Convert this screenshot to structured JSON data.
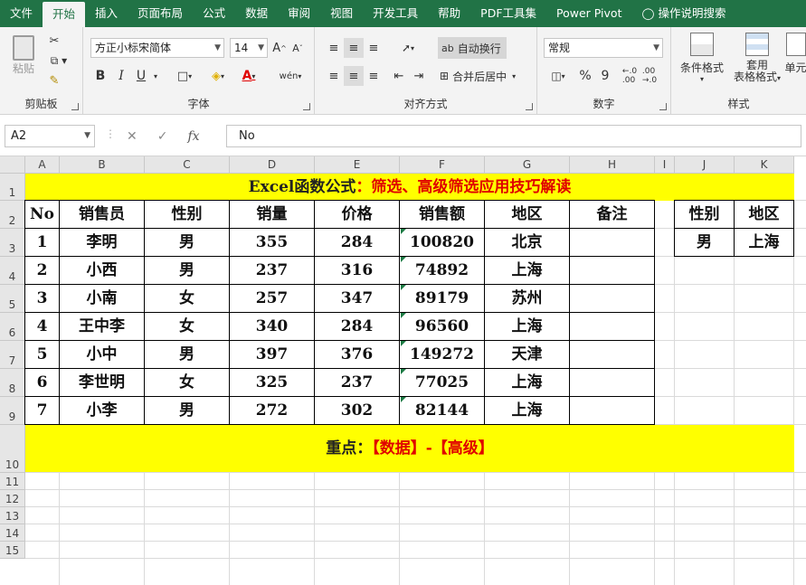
{
  "ribbon_tabs": [
    "文件",
    "开始",
    "插入",
    "页面布局",
    "公式",
    "数据",
    "审阅",
    "视图",
    "开发工具",
    "帮助",
    "PDF工具集",
    "Power Pivot",
    "操作说明搜索"
  ],
  "ribbon": {
    "clipboard": {
      "paste": "粘贴",
      "label": "剪贴板"
    },
    "font": {
      "name": "方正小标宋简体",
      "size": "14",
      "bold": "B",
      "italic": "I",
      "underline": "U",
      "label": "字体",
      "grow": "A",
      "shrink": "A",
      "phonetic": "wén"
    },
    "alignment": {
      "wrap": "自动换行",
      "merge": "合并后居中",
      "label": "对齐方式"
    },
    "number": {
      "format": "常规",
      "percent": "%",
      "comma": "9",
      "label": "数字"
    },
    "styles": {
      "conditional": "条件格式",
      "table_line1": "套用",
      "table_line2": "表格格式",
      "cell": "单元",
      "label": "样式"
    }
  },
  "formula_bar": {
    "name_box": "A2",
    "fx": "fx",
    "value": "No"
  },
  "columns": [
    "A",
    "B",
    "C",
    "D",
    "E",
    "F",
    "G",
    "H",
    "I",
    "J",
    "K"
  ],
  "rows": [
    "1",
    "2",
    "3",
    "4",
    "5",
    "6",
    "7",
    "8",
    "9",
    "10",
    "11",
    "12",
    "13",
    "14",
    "15"
  ],
  "title": {
    "black": "Excel函数公式",
    "red": "：筛选、高级筛选应用技巧解读"
  },
  "footer": {
    "black": "重点：",
    "red": "【数据】-【高级】"
  },
  "table": {
    "headers": [
      "No",
      "销售员",
      "性别",
      "销量",
      "价格",
      "销售额",
      "地区",
      "备注"
    ],
    "rows": [
      [
        "1",
        "李明",
        "男",
        "355",
        "284",
        "100820",
        "北京",
        ""
      ],
      [
        "2",
        "小西",
        "男",
        "237",
        "316",
        "74892",
        "上海",
        ""
      ],
      [
        "3",
        "小南",
        "女",
        "257",
        "347",
        "89179",
        "苏州",
        ""
      ],
      [
        "4",
        "王中李",
        "女",
        "340",
        "284",
        "96560",
        "上海",
        ""
      ],
      [
        "5",
        "小中",
        "男",
        "397",
        "376",
        "149272",
        "天津",
        ""
      ],
      [
        "6",
        "李世明",
        "女",
        "325",
        "237",
        "77025",
        "上海",
        ""
      ],
      [
        "7",
        "小李",
        "男",
        "272",
        "302",
        "82144",
        "上海",
        ""
      ]
    ]
  },
  "criteria": {
    "headers": [
      "性别",
      "地区"
    ],
    "values": [
      "男",
      "上海"
    ]
  }
}
